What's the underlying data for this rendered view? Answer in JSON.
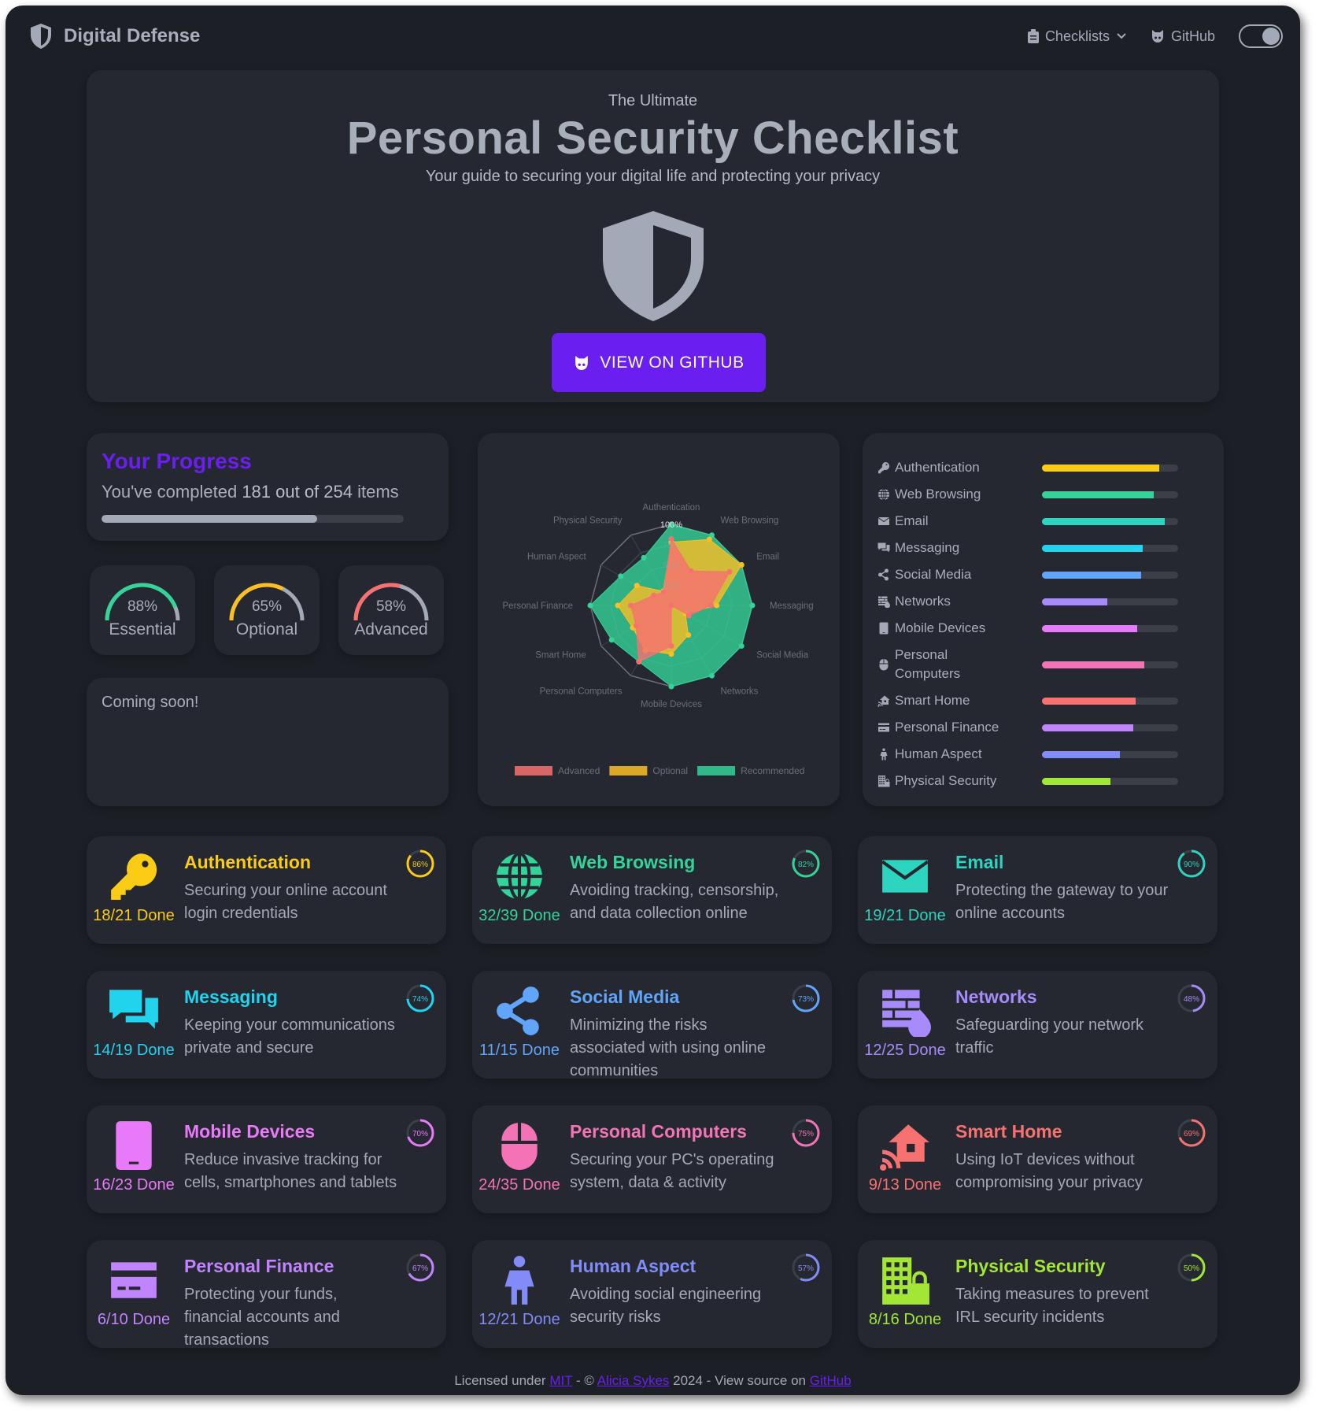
{
  "nav": {
    "brand": "Digital Defense",
    "checklists": "Checklists",
    "github": "GitHub",
    "icons": [
      "shield-icon",
      "clipboard-icon",
      "chevron-down-icon",
      "github-icon",
      "theme-toggle-icon"
    ]
  },
  "hero": {
    "pre": "The Ultimate",
    "title": "Personal Security Checklist",
    "subtitle": "Your guide to securing your digital life and protecting your privacy",
    "button": "VIEW ON GITHUB"
  },
  "progress": {
    "title": "Your Progress",
    "text_pre": "You've completed",
    "completed": "181 out of 254",
    "text_post": "items",
    "percent": 71.3
  },
  "gauges": [
    {
      "pct": "88%",
      "value": 88,
      "label": "Essential",
      "color": "#34d399"
    },
    {
      "pct": "65%",
      "value": 65,
      "label": "Optional",
      "color": "#fbbf24"
    },
    {
      "pct": "58%",
      "value": 58,
      "label": "Advanced",
      "color": "#f87171"
    }
  ],
  "coming_soon": "Coming soon!",
  "chart_data": {
    "type": "radar",
    "labels": [
      "Authentication",
      "Web Browsing",
      "Email",
      "Messaging",
      "Social Media",
      "Networks",
      "Mobile Devices",
      "Personal Computers",
      "Smart Home",
      "Personal Finance",
      "Human Aspect",
      "Physical Security"
    ],
    "ticks": [
      "25%",
      "50%",
      "75%",
      "100%"
    ],
    "range": [
      0,
      100
    ],
    "legend_position": "bottom",
    "series": [
      {
        "name": "Advanced",
        "color": "#f87171",
        "values": [
          82,
          49,
          83,
          49,
          25,
          0,
          50,
          80,
          50,
          50,
          25,
          19
        ]
      },
      {
        "name": "Optional",
        "color": "#fbbf24",
        "values": [
          78,
          94,
          100,
          56,
          20,
          42,
          60,
          64,
          55,
          66,
          49,
          20
        ]
      },
      {
        "name": "Recommended",
        "color": "#34d399",
        "values": [
          100,
          100,
          100,
          100,
          100,
          100,
          100,
          80,
          85,
          100,
          72,
          68
        ]
      }
    ]
  },
  "categories": [
    {
      "title": "Authentication",
      "desc": "Securing your online account login credentials",
      "done": "18/21 Done",
      "pct": 86,
      "color": "#facc15",
      "icon": "key"
    },
    {
      "title": "Web Browsing",
      "desc": "Avoiding tracking, censorship, and data collection online",
      "done": "32/39 Done",
      "pct": 82,
      "color": "#34d399",
      "icon": "globe"
    },
    {
      "title": "Email",
      "desc": "Protecting the gateway to your online accounts",
      "done": "19/21 Done",
      "pct": 90,
      "color": "#2dd4bf",
      "icon": "envelope"
    },
    {
      "title": "Messaging",
      "desc": "Keeping your communications private and secure",
      "done": "14/19 Done",
      "pct": 74,
      "color": "#22d3ee",
      "icon": "chat"
    },
    {
      "title": "Social Media",
      "desc": "Minimizing the risks associated with using online communities",
      "done": "11/15 Done",
      "pct": 73,
      "color": "#60a5fa",
      "icon": "share"
    },
    {
      "title": "Networks",
      "desc": "Safeguarding your network traffic",
      "done": "12/25 Done",
      "pct": 48,
      "color": "#a78bfa",
      "icon": "firewall"
    },
    {
      "title": "Mobile Devices",
      "desc": "Reduce invasive tracking for cells, smartphones and tablets",
      "done": "16/23 Done",
      "pct": 70,
      "color": "#e879f9",
      "icon": "mobile"
    },
    {
      "title": "Personal Computers",
      "desc": "Securing your PC's operating system, data & activity",
      "done": "24/35 Done",
      "pct": 75,
      "color": "#f472b6",
      "icon": "mouse"
    },
    {
      "title": "Smart Home",
      "desc": "Using IoT devices without compromising your privacy",
      "done": "9/13 Done",
      "pct": 69,
      "color": "#f87171",
      "icon": "house-signal"
    },
    {
      "title": "Personal Finance",
      "desc": "Protecting your funds, financial accounts and transactions",
      "done": "6/10 Done",
      "pct": 67,
      "color": "#c084fc",
      "icon": "card"
    },
    {
      "title": "Human Aspect",
      "desc": "Avoiding social engineering security risks",
      "done": "12/21 Done",
      "pct": 57,
      "color": "#818cf8",
      "icon": "person"
    },
    {
      "title": "Physical Security",
      "desc": "Taking measures to prevent IRL security incidents",
      "done": "8/16 Done",
      "pct": 50,
      "color": "#a3e635",
      "icon": "building-lock"
    }
  ],
  "footer": {
    "t1": "Licensed under",
    "mit": "MIT",
    "t2": "- ©",
    "author": "Alicia Sykes",
    "t3": "2024 - View source on",
    "github": "GitHub"
  }
}
